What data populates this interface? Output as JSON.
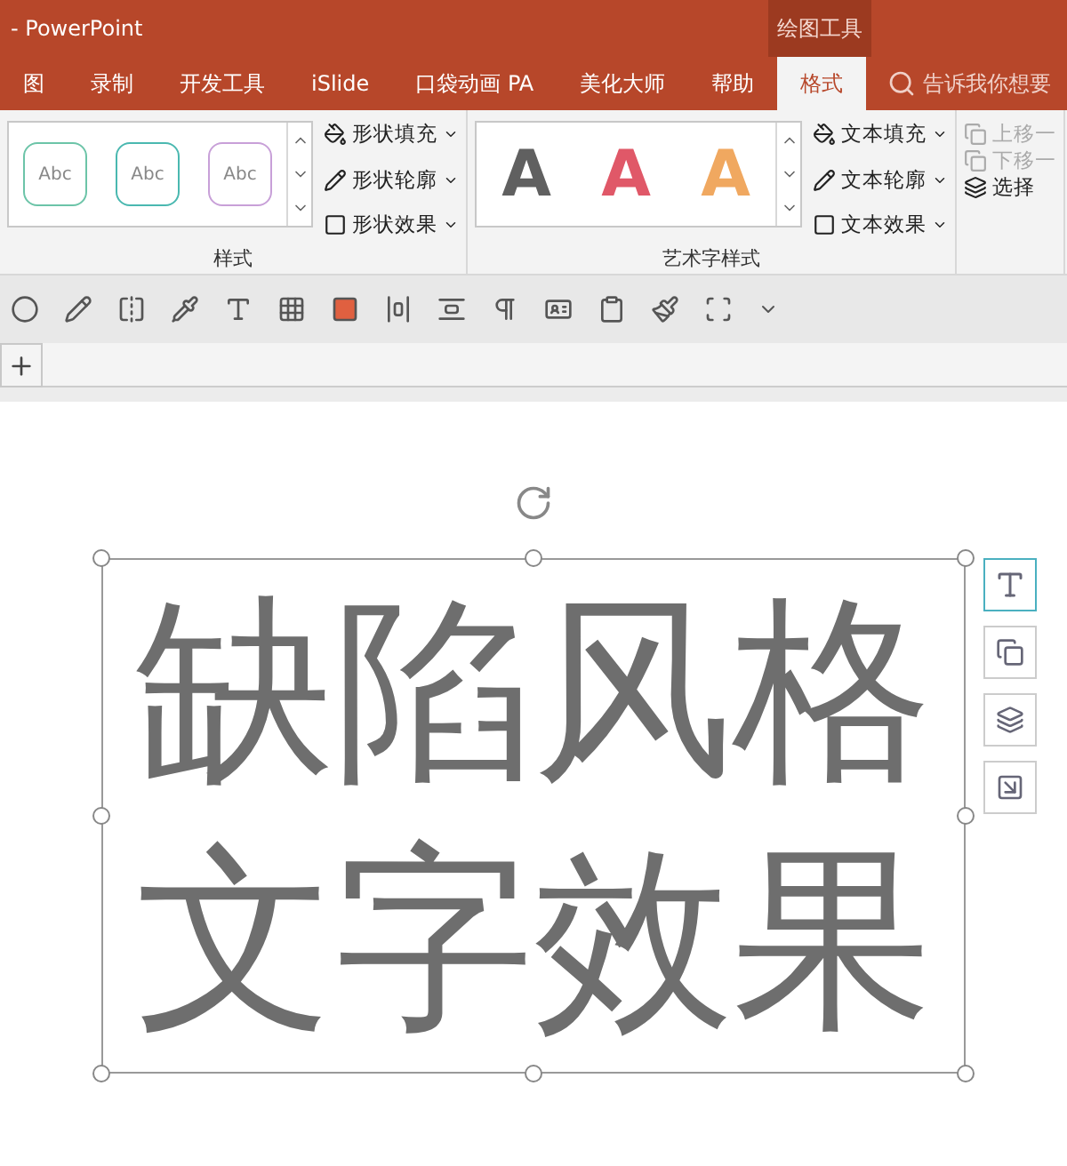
{
  "window": {
    "title": "- PowerPoint",
    "context_tab": "绘图工具"
  },
  "tabs": [
    {
      "label": "图",
      "selected": false
    },
    {
      "label": "录制",
      "selected": false
    },
    {
      "label": "开发工具",
      "selected": false
    },
    {
      "label": "iSlide",
      "selected": false
    },
    {
      "label": "口袋动画 PA",
      "selected": false
    },
    {
      "label": "美化大师",
      "selected": false
    },
    {
      "label": "帮助",
      "selected": false
    },
    {
      "label": "格式",
      "selected": true
    }
  ],
  "search": {
    "placeholder": "告诉我你想要"
  },
  "shape_styles": {
    "label": "样式",
    "gallery": [
      {
        "text": "Abc",
        "color": "#6cc4a8"
      },
      {
        "text": "Abc",
        "color": "#4ab8b0"
      },
      {
        "text": "Abc",
        "color": "#c8a0d8"
      }
    ],
    "commands": [
      "形状填充",
      "形状轮廓",
      "形状效果"
    ]
  },
  "wordart_styles": {
    "label": "艺术字样式",
    "gallery": [
      {
        "text": "A",
        "color": "#606060"
      },
      {
        "text": "A",
        "color": "#e05868"
      },
      {
        "text": "A",
        "color": "#f0a860"
      }
    ],
    "commands": [
      "文本填充",
      "文本轮廓",
      "文本效果"
    ]
  },
  "arrange": {
    "commands": [
      {
        "label": "上移一",
        "disabled": true
      },
      {
        "label": "下移一",
        "disabled": true
      },
      {
        "label": "选择",
        "disabled": false
      }
    ]
  },
  "text_box": {
    "selected": true,
    "lines": [
      "缺陷风格",
      "文字效果"
    ]
  }
}
